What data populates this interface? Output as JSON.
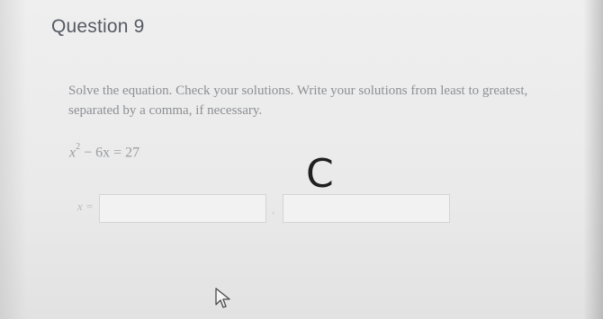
{
  "question": {
    "title": "Question 9",
    "instructions": "Solve the equation. Check your solutions. Write your solutions from least to greatest, separated by a comma, if necessary.",
    "equation": {
      "var": "x",
      "exponent": "2",
      "rest": " − 6x = 27"
    }
  },
  "answer": {
    "variable_label": "x =",
    "separator": ",",
    "input1_value": "",
    "input2_value": ""
  },
  "overlay": {
    "loading_glyph": "C",
    "loading_icon": "loading-spinner-icon",
    "cursor_icon": "mouse-pointer-icon"
  },
  "colors": {
    "title": "#555a62",
    "body_text": "#8d8f93",
    "input_border": "#d4d4d4",
    "background": "#ececec"
  }
}
